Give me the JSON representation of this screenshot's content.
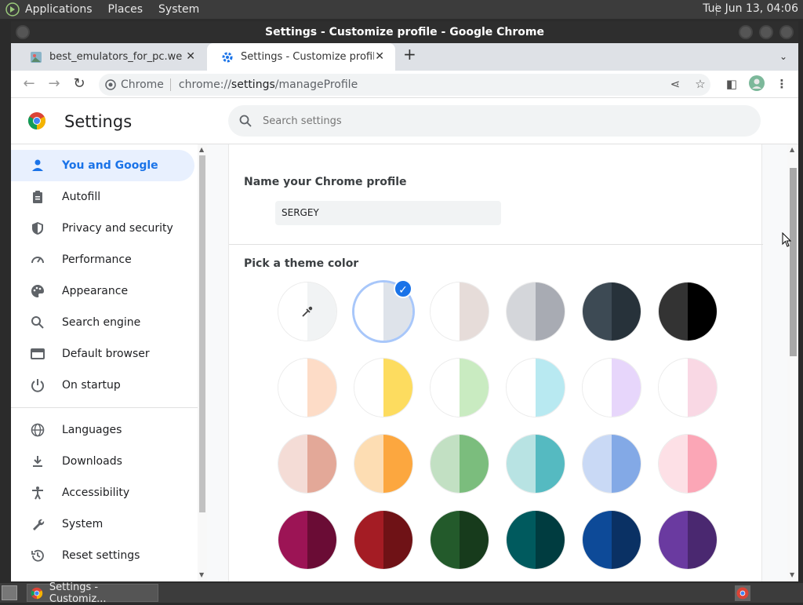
{
  "system_bar": {
    "menus": [
      "Applications",
      "Places",
      "System"
    ],
    "clock": "Tue Jun 13, 04:06"
  },
  "window": {
    "title": "Settings - Customize profile - Google Chrome"
  },
  "tabs": [
    {
      "label": "best_emulators_for_pc.webp (",
      "close": "✕"
    },
    {
      "label": "Settings - Customize profile",
      "close": "✕"
    }
  ],
  "new_tab": "+",
  "omnibox": {
    "chip": "Chrome",
    "url_prefix": "chrome://",
    "url_host": "settings",
    "url_path": "/manageProfile"
  },
  "settings": {
    "title": "Settings",
    "search_placeholder": "Search settings"
  },
  "sidebar": {
    "items": [
      {
        "label": "You and Google",
        "icon": "person-icon"
      },
      {
        "label": "Autofill",
        "icon": "clipboard-icon"
      },
      {
        "label": "Privacy and security",
        "icon": "shield-icon"
      },
      {
        "label": "Performance",
        "icon": "speedometer-icon"
      },
      {
        "label": "Appearance",
        "icon": "palette-icon"
      },
      {
        "label": "Search engine",
        "icon": "search-icon"
      },
      {
        "label": "Default browser",
        "icon": "browser-icon"
      },
      {
        "label": "On startup",
        "icon": "power-icon"
      },
      {
        "label": "Languages",
        "icon": "globe-icon"
      },
      {
        "label": "Downloads",
        "icon": "download-icon"
      },
      {
        "label": "Accessibility",
        "icon": "accessibility-icon"
      },
      {
        "label": "System",
        "icon": "wrench-icon"
      },
      {
        "label": "Reset settings",
        "icon": "history-icon"
      }
    ]
  },
  "profile": {
    "name_label": "Name your Chrome profile",
    "name_value": "SERGEY",
    "theme_label": "Pick a theme color"
  },
  "theme_colors": [
    [
      {
        "l": "#ffffff",
        "r": "#f1f3f4",
        "picker": true
      },
      {
        "l": "#ffffff",
        "r": "#dee3ea",
        "selected": true
      },
      {
        "l": "#ffffff",
        "r": "#e6dcd9"
      },
      {
        "l": "#d4d6da",
        "r": "#a8abb3"
      },
      {
        "l": "#3d4a54",
        "r": "#27323a"
      },
      {
        "l": "#333333",
        "r": "#000000"
      }
    ],
    [
      {
        "l": "#ffffff",
        "r": "#fddcc7"
      },
      {
        "l": "#ffffff",
        "r": "#fddc5f"
      },
      {
        "l": "#ffffff",
        "r": "#c9ebc1"
      },
      {
        "l": "#ffffff",
        "r": "#b8e9f1"
      },
      {
        "l": "#ffffff",
        "r": "#e7d6fb"
      },
      {
        "l": "#ffffff",
        "r": "#f9d8e4"
      }
    ],
    [
      {
        "l": "#f4dcd6",
        "r": "#e3a898"
      },
      {
        "l": "#fdddb3",
        "r": "#fca73f"
      },
      {
        "l": "#c2e0c3",
        "r": "#7bbd7d"
      },
      {
        "l": "#b8e3e3",
        "r": "#55bac1"
      },
      {
        "l": "#c9d9f5",
        "r": "#83a9e6"
      },
      {
        "l": "#fde0e6",
        "r": "#fba6b6"
      }
    ],
    [
      {
        "l": "#9c1455",
        "r": "#6a0c35"
      },
      {
        "l": "#a41c24",
        "r": "#6f1216"
      },
      {
        "l": "#235a2b",
        "r": "#173b1c"
      },
      {
        "l": "#005a5e",
        "r": "#003c40"
      },
      {
        "l": "#0d4a98",
        "r": "#0a3164"
      },
      {
        "l": "#6a3aa0",
        "r": "#4a2870"
      }
    ]
  ],
  "taskbar": {
    "task_label": "Settings - Customiz..."
  }
}
